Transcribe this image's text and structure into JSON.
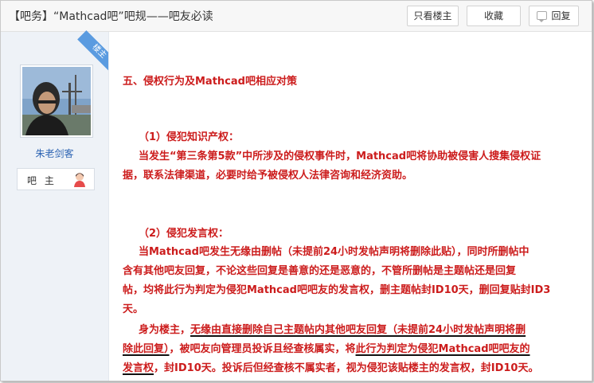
{
  "header": {
    "title": "【吧务】“Mathcad吧”吧规——吧友必读",
    "btn_only_lz": "只看楼主",
    "btn_favorite": "收藏",
    "btn_reply": "回复"
  },
  "author": {
    "ribbon": "楼主",
    "name": "朱老剑客",
    "role": "吧 主"
  },
  "post": {
    "section_title": "五、侵权行为及Mathcad吧相应对策",
    "sub1_title": "（1）侵犯知识产权：",
    "sub1_line1": "当发生“第三条第5款”中所涉及的侵权事件时，Mathcad吧将协助被侵害人搜集侵权证",
    "sub1_line2": "据，联系法律渠道，必要时给予被侵权人法律咨询和经济资助。",
    "sub2_title": "（2）侵犯发言权：",
    "sub2_line1": "当Mathcad吧发生无缘由删帖（未提前24小时发帖声明将删除此贴），同时所删帖中",
    "sub2_line2": "含有其他吧友回复，不论这些回复是善意的还是恶意的，不管所删帖是主题帖还是回复",
    "sub2_line3": "帖，均将此行为判定为侵犯Mathcad吧吧友的发言权，删主题帖封ID10天，删回复贴封ID3",
    "sub2_line4": "天。",
    "p3_a": "身为楼主，",
    "p3_b": "无缘由直接删除自己主题帖内其他吧友回复（未提前24小时发帖声明将删",
    "p3_c": "除此回复）",
    "p3_d": "，被吧友向管理员投诉且经查核属实，将",
    "p3_e": "此行为判定为侵犯Mathcad吧吧友的",
    "p3_f": "发言权",
    "p3_g": "，封ID10天。投诉后但经查核不属实者，视为侵犯该贴楼主的发言权，封ID10天。"
  }
}
